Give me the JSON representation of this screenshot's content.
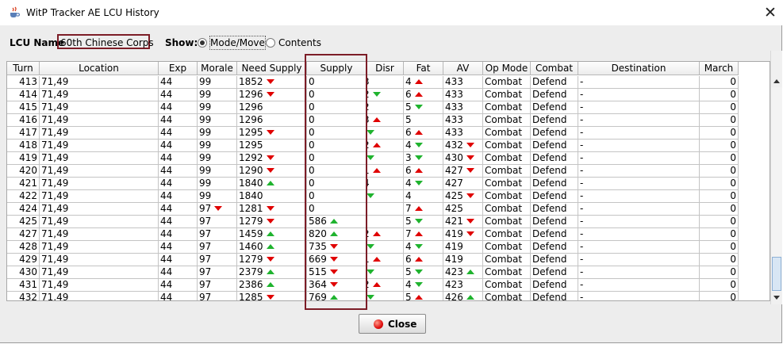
{
  "window": {
    "title": "WitP Tracker AE LCU History",
    "close_glyph": "✕"
  },
  "lcu": {
    "label": "LCU Name",
    "value": "60th Chinese Corps"
  },
  "show": {
    "label": "Show:",
    "options": [
      {
        "label": "Mode/Move",
        "selected": true
      },
      {
        "label": "Contents",
        "selected": false
      }
    ]
  },
  "columns": [
    "Turn",
    "Location",
    "Exp",
    "Morale",
    "Need Supply",
    "Supply",
    "Disr",
    "Fat",
    "AV",
    "Op Mode",
    "Combat",
    "Destination",
    "March"
  ],
  "rows": [
    {
      "turn": "413",
      "loc": "71,49",
      "exp": "44",
      "morale": "99",
      "morale_t": "",
      "need": "1852",
      "need_t": "down",
      "supply": "0",
      "supply_t": "",
      "disr": "3",
      "disr_t": "",
      "fat": "4",
      "fat_t": "up",
      "av": "433",
      "av_t": "",
      "mode": "Combat",
      "combat": "Defend",
      "dest": "-",
      "march": "0"
    },
    {
      "turn": "414",
      "loc": "71,49",
      "exp": "44",
      "morale": "99",
      "morale_t": "",
      "need": "1296",
      "need_t": "down",
      "supply": "0",
      "supply_t": "",
      "disr": "2",
      "disr_t": "down",
      "fat": "6",
      "fat_t": "up",
      "av": "433",
      "av_t": "",
      "mode": "Combat",
      "combat": "Defend",
      "dest": "-",
      "march": "0"
    },
    {
      "turn": "415",
      "loc": "71,49",
      "exp": "44",
      "morale": "99",
      "morale_t": "",
      "need": "1296",
      "need_t": "",
      "supply": "0",
      "supply_t": "",
      "disr": "2",
      "disr_t": "",
      "fat": "5",
      "fat_t": "down",
      "av": "433",
      "av_t": "",
      "mode": "Combat",
      "combat": "Defend",
      "dest": "-",
      "march": "0"
    },
    {
      "turn": "416",
      "loc": "71,49",
      "exp": "44",
      "morale": "99",
      "morale_t": "",
      "need": "1296",
      "need_t": "",
      "supply": "0",
      "supply_t": "",
      "disr": "3",
      "disr_t": "up",
      "fat": "5",
      "fat_t": "",
      "av": "433",
      "av_t": "",
      "mode": "Combat",
      "combat": "Defend",
      "dest": "-",
      "march": "0"
    },
    {
      "turn": "417",
      "loc": "71,49",
      "exp": "44",
      "morale": "99",
      "morale_t": "",
      "need": "1295",
      "need_t": "down",
      "supply": "0",
      "supply_t": "",
      "disr": "",
      "disr_t": "down",
      "fat": "6",
      "fat_t": "up",
      "av": "433",
      "av_t": "",
      "mode": "Combat",
      "combat": "Defend",
      "dest": "-",
      "march": "0"
    },
    {
      "turn": "418",
      "loc": "71,49",
      "exp": "44",
      "morale": "99",
      "morale_t": "",
      "need": "1295",
      "need_t": "",
      "supply": "0",
      "supply_t": "",
      "disr": "2",
      "disr_t": "up",
      "fat": "4",
      "fat_t": "down",
      "av": "432",
      "av_t": "down",
      "mode": "Combat",
      "combat": "Defend",
      "dest": "-",
      "march": "0"
    },
    {
      "turn": "419",
      "loc": "71,49",
      "exp": "44",
      "morale": "99",
      "morale_t": "",
      "need": "1292",
      "need_t": "down",
      "supply": "0",
      "supply_t": "",
      "disr": "",
      "disr_t": "down",
      "fat": "3",
      "fat_t": "down",
      "av": "430",
      "av_t": "down",
      "mode": "Combat",
      "combat": "Defend",
      "dest": "-",
      "march": "0"
    },
    {
      "turn": "420",
      "loc": "71,49",
      "exp": "44",
      "morale": "99",
      "morale_t": "",
      "need": "1290",
      "need_t": "down",
      "supply": "0",
      "supply_t": "",
      "disr": "1",
      "disr_t": "up",
      "fat": "6",
      "fat_t": "up",
      "av": "427",
      "av_t": "down",
      "mode": "Combat",
      "combat": "Defend",
      "dest": "-",
      "march": "0"
    },
    {
      "turn": "421",
      "loc": "71,49",
      "exp": "44",
      "morale": "99",
      "morale_t": "",
      "need": "1840",
      "need_t": "up",
      "supply": "0",
      "supply_t": "",
      "disr": "4",
      "disr_t": "",
      "fat": "4",
      "fat_t": "down",
      "av": "427",
      "av_t": "",
      "mode": "Combat",
      "combat": "Defend",
      "dest": "-",
      "march": "0"
    },
    {
      "turn": "422",
      "loc": "71,49",
      "exp": "44",
      "morale": "99",
      "morale_t": "",
      "need": "1840",
      "need_t": "",
      "supply": "0",
      "supply_t": "",
      "disr": "",
      "disr_t": "down",
      "fat": "4",
      "fat_t": "",
      "av": "425",
      "av_t": "down",
      "mode": "Combat",
      "combat": "Defend",
      "dest": "-",
      "march": "0"
    },
    {
      "turn": "424",
      "loc": "71,49",
      "exp": "44",
      "morale": "97",
      "morale_t": "down",
      "need": "1281",
      "need_t": "down",
      "supply": "0",
      "supply_t": "",
      "disr": "",
      "disr_t": "",
      "fat": "7",
      "fat_t": "up",
      "av": "425",
      "av_t": "",
      "mode": "Combat",
      "combat": "Defend",
      "dest": "-",
      "march": "0"
    },
    {
      "turn": "425",
      "loc": "71,49",
      "exp": "44",
      "morale": "97",
      "morale_t": "",
      "need": "1279",
      "need_t": "down",
      "supply": "586",
      "supply_t": "up",
      "disr": "",
      "disr_t": "",
      "fat": "5",
      "fat_t": "down",
      "av": "421",
      "av_t": "down",
      "mode": "Combat",
      "combat": "Defend",
      "dest": "-",
      "march": "0"
    },
    {
      "turn": "427",
      "loc": "71,49",
      "exp": "44",
      "morale": "97",
      "morale_t": "",
      "need": "1459",
      "need_t": "up",
      "supply": "820",
      "supply_t": "up",
      "disr": "2",
      "disr_t": "up",
      "fat": "7",
      "fat_t": "up",
      "av": "419",
      "av_t": "down",
      "mode": "Combat",
      "combat": "Defend",
      "dest": "-",
      "march": "0"
    },
    {
      "turn": "428",
      "loc": "71,49",
      "exp": "44",
      "morale": "97",
      "morale_t": "",
      "need": "1460",
      "need_t": "up",
      "supply": "735",
      "supply_t": "down",
      "disr": "",
      "disr_t": "down",
      "fat": "4",
      "fat_t": "down",
      "av": "419",
      "av_t": "",
      "mode": "Combat",
      "combat": "Defend",
      "dest": "-",
      "march": "0"
    },
    {
      "turn": "429",
      "loc": "71,49",
      "exp": "44",
      "morale": "97",
      "morale_t": "",
      "need": "1279",
      "need_t": "down",
      "supply": "669",
      "supply_t": "down",
      "disr": "1",
      "disr_t": "up",
      "fat": "6",
      "fat_t": "up",
      "av": "419",
      "av_t": "",
      "mode": "Combat",
      "combat": "Defend",
      "dest": "-",
      "march": "0"
    },
    {
      "turn": "430",
      "loc": "71,49",
      "exp": "44",
      "morale": "97",
      "morale_t": "",
      "need": "2379",
      "need_t": "up",
      "supply": "515",
      "supply_t": "down",
      "disr": "",
      "disr_t": "down",
      "fat": "5",
      "fat_t": "down",
      "av": "423",
      "av_t": "up",
      "mode": "Combat",
      "combat": "Defend",
      "dest": "-",
      "march": "0"
    },
    {
      "turn": "431",
      "loc": "71,49",
      "exp": "44",
      "morale": "97",
      "morale_t": "",
      "need": "2386",
      "need_t": "up",
      "supply": "364",
      "supply_t": "down",
      "disr": "2",
      "disr_t": "up",
      "fat": "4",
      "fat_t": "down",
      "av": "423",
      "av_t": "",
      "mode": "Combat",
      "combat": "Defend",
      "dest": "-",
      "march": "0"
    },
    {
      "turn": "432",
      "loc": "71,49",
      "exp": "44",
      "morale": "97",
      "morale_t": "",
      "need": "1285",
      "need_t": "down",
      "supply": "769",
      "supply_t": "up",
      "disr": "",
      "disr_t": "down",
      "fat": "5",
      "fat_t": "up",
      "av": "426",
      "av_t": "up",
      "mode": "Combat",
      "combat": "Defend",
      "dest": "-",
      "march": "0"
    }
  ],
  "footer": {
    "close_label": "Close"
  },
  "colors": {
    "trend_up": "#1fb32e",
    "trend_down": "#e00000",
    "highlight": "#7c1d27"
  },
  "icons": {
    "app": "java-cup-icon",
    "close_button": "red-ball-icon"
  }
}
